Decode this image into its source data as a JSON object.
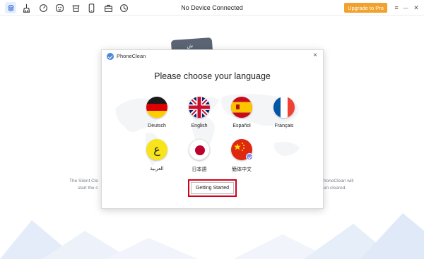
{
  "toolbar": {
    "icons": [
      "fingerprint-icon",
      "broom-icon",
      "speedometer-icon",
      "face-icon",
      "bin-icon",
      "phone-icon",
      "briefcase-icon",
      "history-icon"
    ],
    "title": "No Device Connected",
    "upgrade_label": "Upgrade to Pro",
    "menu_glyph": "≡",
    "minimize_glyph": "—",
    "close_glyph": "✕"
  },
  "background": {
    "phone_glyph": "ش",
    "left_text": [
      "The Silent Cle",
      "start the c"
    ],
    "right_text": [
      "honeClean will",
      "en cleared."
    ]
  },
  "dialog": {
    "app_name": "PhoneClean",
    "close_glyph": "×",
    "heading": "Please choose your language",
    "languages": [
      {
        "label": "Deutsch"
      },
      {
        "label": "English"
      },
      {
        "label": "Español"
      },
      {
        "label": "Français"
      },
      {
        "label": "العربية",
        "flag_glyph": "ع"
      },
      {
        "label": "日本語"
      },
      {
        "label": "簡体中文",
        "selected": true
      }
    ],
    "start_button": "Getting Started"
  },
  "colors": {
    "accent": "#4a86d9",
    "upgrade": "#f2a12c",
    "highlight_border": "#d0021b",
    "selected_check": "#7b8ff0"
  }
}
